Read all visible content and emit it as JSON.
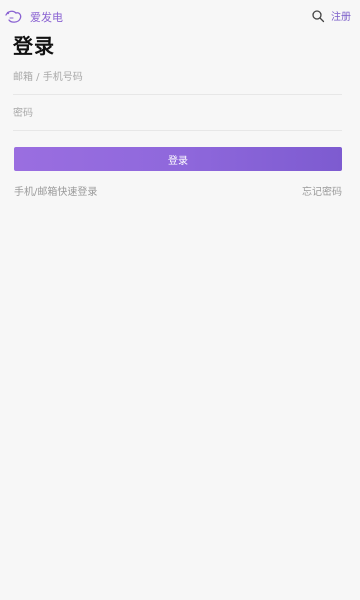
{
  "header": {
    "brand_name": "爱发电",
    "register_label": "注册",
    "icons": {
      "logo": "aifadian-logo-icon",
      "search": "search-icon"
    },
    "accent_color": "#8a63d2"
  },
  "main": {
    "title": "登录",
    "email_field": {
      "placeholder": "邮箱 / 手机号码",
      "value": ""
    },
    "password_field": {
      "placeholder": "密码",
      "value": ""
    },
    "login_button_label": "登录",
    "quick_login_label": "手机/邮箱快速登录",
    "forgot_password_label": "忘记密码"
  }
}
